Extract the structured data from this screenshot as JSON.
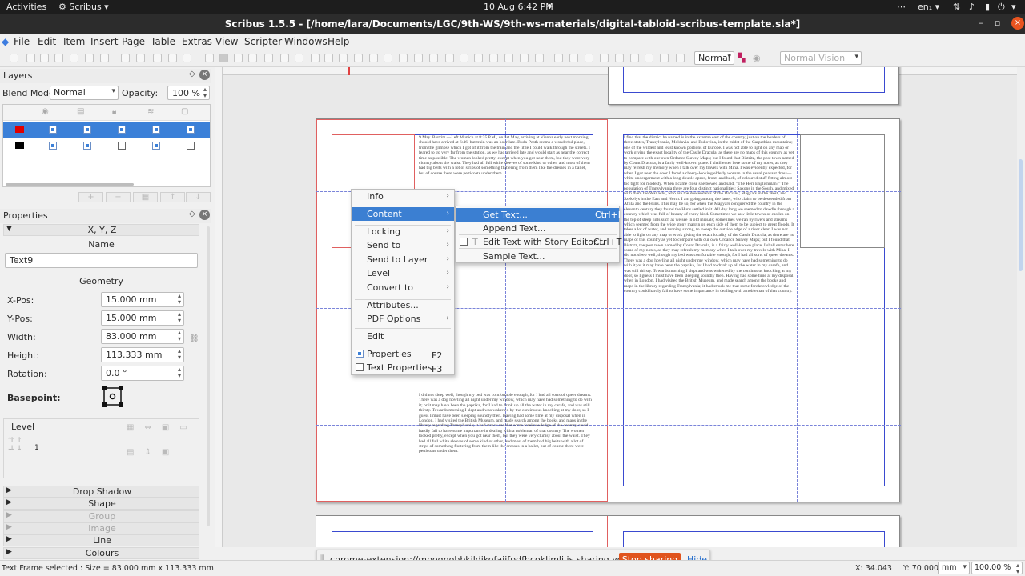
{
  "topbar": {
    "activities": "Activities",
    "app_name": "Scribus",
    "app_arrow": "▾",
    "clock": "10 Aug  6:42 PM",
    "lang": "en₁",
    "lang_arrow": "▾",
    "power_arrow": "▾"
  },
  "window": {
    "title": "Scribus 1.5.5 - [/home/lara/Documents/LGC/9th-WS/9th-ws-materials/digital-tabloid-scribus-template.sla*]",
    "minimize": "–",
    "restore": "▫",
    "close": "×"
  },
  "menubar": [
    "File",
    "Edit",
    "Item",
    "Insert",
    "Page",
    "Table",
    "Extras",
    "View",
    "Scripter",
    "Windows",
    "Help"
  ],
  "toolbar": {
    "mode_value": "Normal",
    "vision_value": "Normal Vision",
    "combo_arrow": "▾"
  },
  "layers": {
    "title": "Layers",
    "blend_label": "Blend Mode:",
    "blend_value": "Normal",
    "opacity_label": "Opacity:",
    "opacity_value": "100 %",
    "rows": [
      {
        "color": "#e00000",
        "selected": true,
        "checks": [
          true,
          true,
          true,
          true,
          true
        ]
      },
      {
        "color": "#000000",
        "selected": false,
        "checks": [
          true,
          true,
          false,
          true,
          false
        ]
      }
    ]
  },
  "properties": {
    "title": "Properties",
    "xyz_tab": "X, Y, Z",
    "name_label": "Name",
    "name_value": "Text9",
    "geometry_label": "Geometry",
    "xpos_label": "X-Pos:",
    "xpos_value": "15.000 mm",
    "ypos_label": "Y-Pos:",
    "ypos_value": "15.000 mm",
    "width_label": "Width:",
    "width_value": "83.000 mm",
    "height_label": "Height:",
    "height_value": "113.333 mm",
    "rotation_label": "Rotation:",
    "rotation_value": "0.0 °",
    "basepoint_label": "Basepoint:",
    "level_label": "Level",
    "level_value": "1",
    "sections": [
      {
        "label": "Drop Shadow",
        "enabled": true
      },
      {
        "label": "Shape",
        "enabled": true
      },
      {
        "label": "Group",
        "enabled": false
      },
      {
        "label": "Image",
        "enabled": false
      },
      {
        "label": "Line",
        "enabled": true
      },
      {
        "label": "Colours",
        "enabled": true
      }
    ]
  },
  "context_menu": {
    "items": [
      "Info",
      "Content",
      "Locking",
      "Send to",
      "Send to Layer",
      "Level",
      "Convert to",
      "Attributes...",
      "PDF Options",
      "Edit",
      "Properties",
      "Text Properties"
    ],
    "properties_shortcut": "F2",
    "text_properties_shortcut": "F3",
    "highlighted": "Content"
  },
  "submenu": {
    "items": [
      {
        "label": "Get Text...",
        "shortcut": "Ctrl+I"
      },
      {
        "label": "Append Text...",
        "shortcut": ""
      },
      {
        "label": "Edit Text with Story Editor...",
        "shortcut": "Ctrl+T"
      },
      {
        "label": "Sample Text...",
        "shortcut": ""
      }
    ]
  },
  "document": {
    "col1": "9 May. Bistritz.—Left Munich at 8:35 P.M., on 1st May, arriving at Vienna early next morning; should have arrived at 6:46, but train was an hour late. Buda-Pesth seems a wonderful place, from the glimpse which I got of it from the train and the little I could walk through the streets. I feared to go very far from the station, as we had arrived late and would start as near the correct time as possible.\n\nThe women looked pretty, except when you got near them, but they were very clumsy about the waist. They had all full white sleeves of some kind or other, and most of them had big belts with a lot of strips of something fluttering from them like the dresses in a ballet, but of course there were petticoats under them.",
    "col2": "I find that the district he named is in the extreme east of the country, just on the borders of three states, Transylvania, Moldavia, and Bukovina, in the midst of the Carpathian mountains; one of the wildest and least known portions of Europe.\n\nI was not able to light on any map or work giving the exact locality of the Castle Dracula, as there are no maps of this country as yet to compare with our own Ordance Survey Maps; but I found that Bistritz, the post town named by Count Dracula, is a fairly well-known place. I shall enter here some of my notes, as they may refresh my memory when I talk over my travels with Mina.\n\nI was evidently expected, for when I got near the door I faced a cheery-looking elderly woman in the usual peasant dress—white undergarment with a long double apron, front, and back, of coloured stuff fitting almost too tight for modesty. When I came close she bowed and said, \"The Herr Englishman?\"\n\nThe population of Transylvania there are four distinct nationalities: Saxons in the South, and mixed with them the Wallachs, who are the descendants of the Dacians; Magyars in the West, and Szekelys in the East and North. I am going among the latter, who claim to be descended from Attila and the Huns. This may be so, for when the Magyars conquered the country in the eleventh century they found the Huns settled in it.\n\nAll day long we seemed to dawdle through a country which was full of beauty of every kind. Sometimes we saw little towns or castles on the top of steep hills such as we see in old missals; sometimes we ran by rivers and streams which seemed from the wide stony margin on each side of them to be subject to great floods. It takes a lot of water, and running strong, to sweep the outside edge of a river clear.\n\nI was not able to light on any map or work giving the exact locality of the Castle Dracula, as there are no maps of this country as yet to compare with our own Ordance Survey Maps; but I found that Bistritz, the post town named by Count Dracula, is a fairly well-known place. I shall enter here some of my notes, as they may refresh my memory when I talk over my travels with Mina.\n\nI did not sleep well, though my bed was comfortable enough, for I had all sorts of queer dreams. There was a dog howling all night under my window, which may have had something to do with it; or it may have been the paprika, for I had to drink up all the water in my carafe, and was still thirsty. Towards morning I slept and was wakened by the continuous knocking at my door, so I guess I must have been sleeping soundly then.\n\nHaving had some time at my disposal when in London, I had visited the British Museum, and made search among the books and maps in the library regarding Transylvania; it had struck me that some foreknowledge of the country could hardly fail to have some importance in dealing with a nobleman of that country.",
    "col1b": "I did not sleep well, though my bed was comfortable enough, for I had all sorts of queer dreams. There was a dog howling all night under my window, which may have had something to do with it; or it may have been the paprika, for I had to drink up all the water in my carafe, and was still thirsty. Towards morning I slept and was wakened by the continuous knocking at my door, so I guess I must have been sleeping soundly then.\n\nHaving had some time at my disposal when in London, I had visited the British Museum, and made search among the books and maps in the library regarding Transylvania; it had struck me that some foreknowledge of the country could hardly fail to have some importance in dealing with a nobleman of that country.\n\nThe women looked pretty, except when you got near them, but they were very clumsy about the waist. They had all full white sleeves of some kind or other, and most of them had big belts with a lot of strips of something fluttering from them like the dresses in a ballet, but of course there were petticoats under them."
  },
  "share_bar": {
    "message": "chrome-extension://mpognobbkildjkofajifpdfhcoklimli is sharing your screen.",
    "stop": "Stop sharing",
    "hide": "Hide"
  },
  "status": {
    "selection": "Text Frame selected : Size = 83.000 mm x 113.333 mm",
    "x": "X: 34.043",
    "y": "Y: 70.000",
    "unit": "mm",
    "zoom": "100.00 %"
  }
}
